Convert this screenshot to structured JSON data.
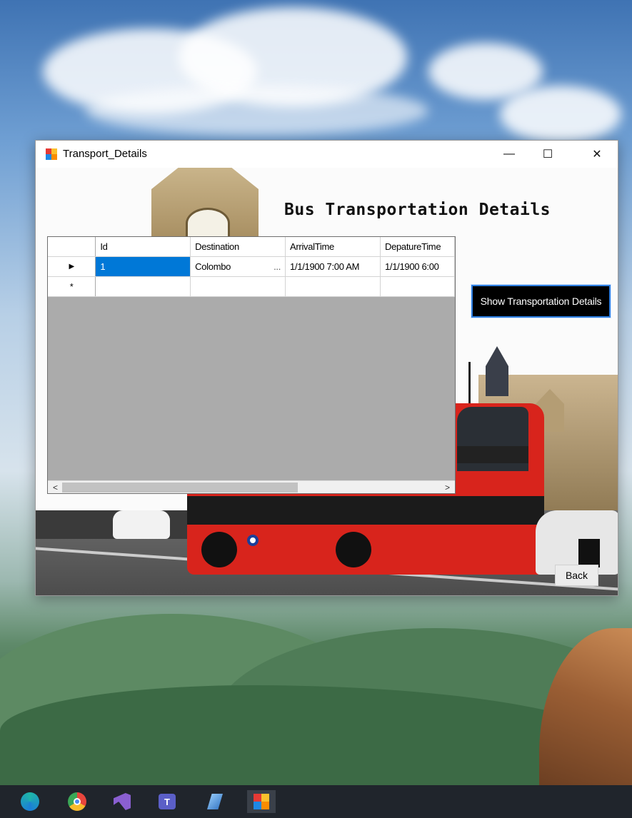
{
  "window": {
    "title": "Transport_Details",
    "minimize_glyph": "—",
    "maximize_glyph": "☐",
    "close_glyph": "✕"
  },
  "form": {
    "heading": "Bus Transportation Details",
    "show_button_label": "Show Transportation Details",
    "back_button_label": "Back"
  },
  "grid": {
    "columns": [
      "Id",
      "Destination",
      "ArrivalTime",
      "DepatureTime"
    ],
    "rows": [
      {
        "indicator": "▶",
        "id": "1",
        "destination": "Colombo",
        "destination_more": "...",
        "arrival": "1/1/1900 7:00 AM",
        "departure": "1/1/1900 6:00"
      }
    ],
    "new_row_indicator": "*",
    "scroll_left": "<",
    "scroll_right": ">"
  },
  "taskbar": {
    "items": [
      "edge-icon",
      "chrome-icon",
      "visual-studio-icon",
      "teams-icon",
      "app-icon-blue",
      "transport-app-icon"
    ]
  },
  "colors": {
    "selection": "#0078d7",
    "button_bg": "#000000",
    "button_border": "#2f7fe0",
    "taskbar": "#20252c",
    "bus_red": "#d8241c"
  }
}
